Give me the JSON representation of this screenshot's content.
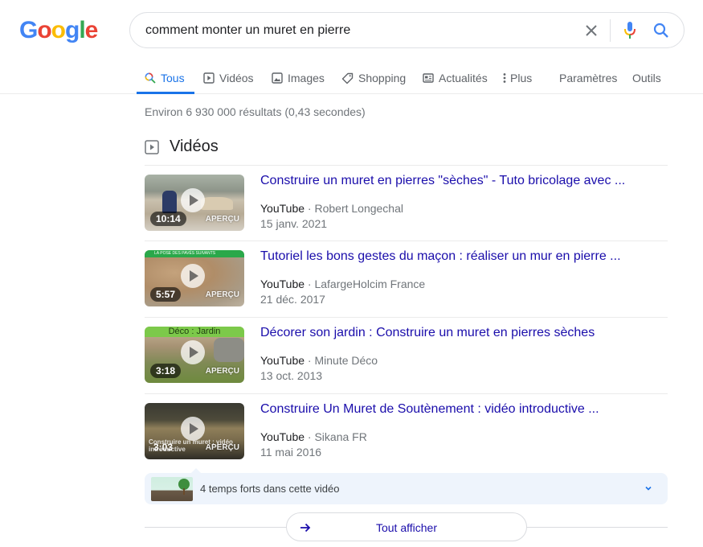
{
  "logo": {
    "letters": [
      {
        "char": "G",
        "color": "#4285f4"
      },
      {
        "char": "o",
        "color": "#ea4335"
      },
      {
        "char": "o",
        "color": "#fbbc05"
      },
      {
        "char": "g",
        "color": "#4285f4"
      },
      {
        "char": "l",
        "color": "#34a853"
      },
      {
        "char": "e",
        "color": "#ea4335"
      }
    ]
  },
  "search": {
    "query": "comment monter un muret en pierre",
    "clear_icon": "close-icon",
    "mic_icon": "microphone-icon",
    "search_icon": "search-icon"
  },
  "tabs": [
    {
      "label": "Tous",
      "icon": "search-icon",
      "active": true
    },
    {
      "label": "Vidéos",
      "icon": "play-icon",
      "active": false
    },
    {
      "label": "Images",
      "icon": "image-icon",
      "active": false
    },
    {
      "label": "Shopping",
      "icon": "tag-icon",
      "active": false
    },
    {
      "label": "Actualités",
      "icon": "newspaper-icon",
      "active": false
    },
    {
      "label": "Plus",
      "icon": "more-vert-icon",
      "active": false
    },
    {
      "label": "Paramètres",
      "icon": null,
      "active": false
    },
    {
      "label": "Outils",
      "icon": null,
      "active": false
    }
  ],
  "result_stats": "Environ 6 930 000 résultats (0,43 secondes)",
  "videos_section": {
    "title": "Vidéos",
    "icon": "play-icon",
    "items": [
      {
        "title": "Construire un muret en pierres \"sèches\" - Tuto bricolage avec ...",
        "site": "YouTube",
        "channel": "Robert Longechal",
        "date": "15 janv. 2021",
        "duration": "10:14",
        "preview_label": "APERÇU"
      },
      {
        "title": "Tutoriel les bons gestes du maçon : réaliser un mur en pierre ...",
        "site": "YouTube",
        "channel": "LafargeHolcim France",
        "date": "21 déc. 2017",
        "duration": "5:57",
        "preview_label": "APERÇU",
        "thumb_banner": "LA POSE DES PAVÉS SUIVANTS"
      },
      {
        "title": "Décorer son jardin : Construire un muret en pierres sèches",
        "site": "YouTube",
        "channel": "Minute Déco",
        "date": "13 oct. 2013",
        "duration": "3:18",
        "preview_label": "APERÇU",
        "thumb_banner": "Déco : Jardin"
      },
      {
        "title": "Construire Un Muret de Soutènement : vidéo introductive ...",
        "site": "YouTube",
        "channel": "Sikana FR",
        "date": "11 mai 2016",
        "duration": "3:03",
        "preview_label": "APERÇU",
        "thumb_overlay": "Construire un muret : vidéo introductive"
      }
    ],
    "separator": " · ",
    "key_moments": {
      "label": "4 temps forts dans cette vidéo",
      "icon": "chevron-down-icon"
    },
    "show_all": {
      "label": "Tout afficher",
      "icon": "arrow-right-icon"
    }
  },
  "colors": {
    "link": "#1a0dab",
    "accent": "#1a73e8",
    "muted": "#70757a"
  }
}
